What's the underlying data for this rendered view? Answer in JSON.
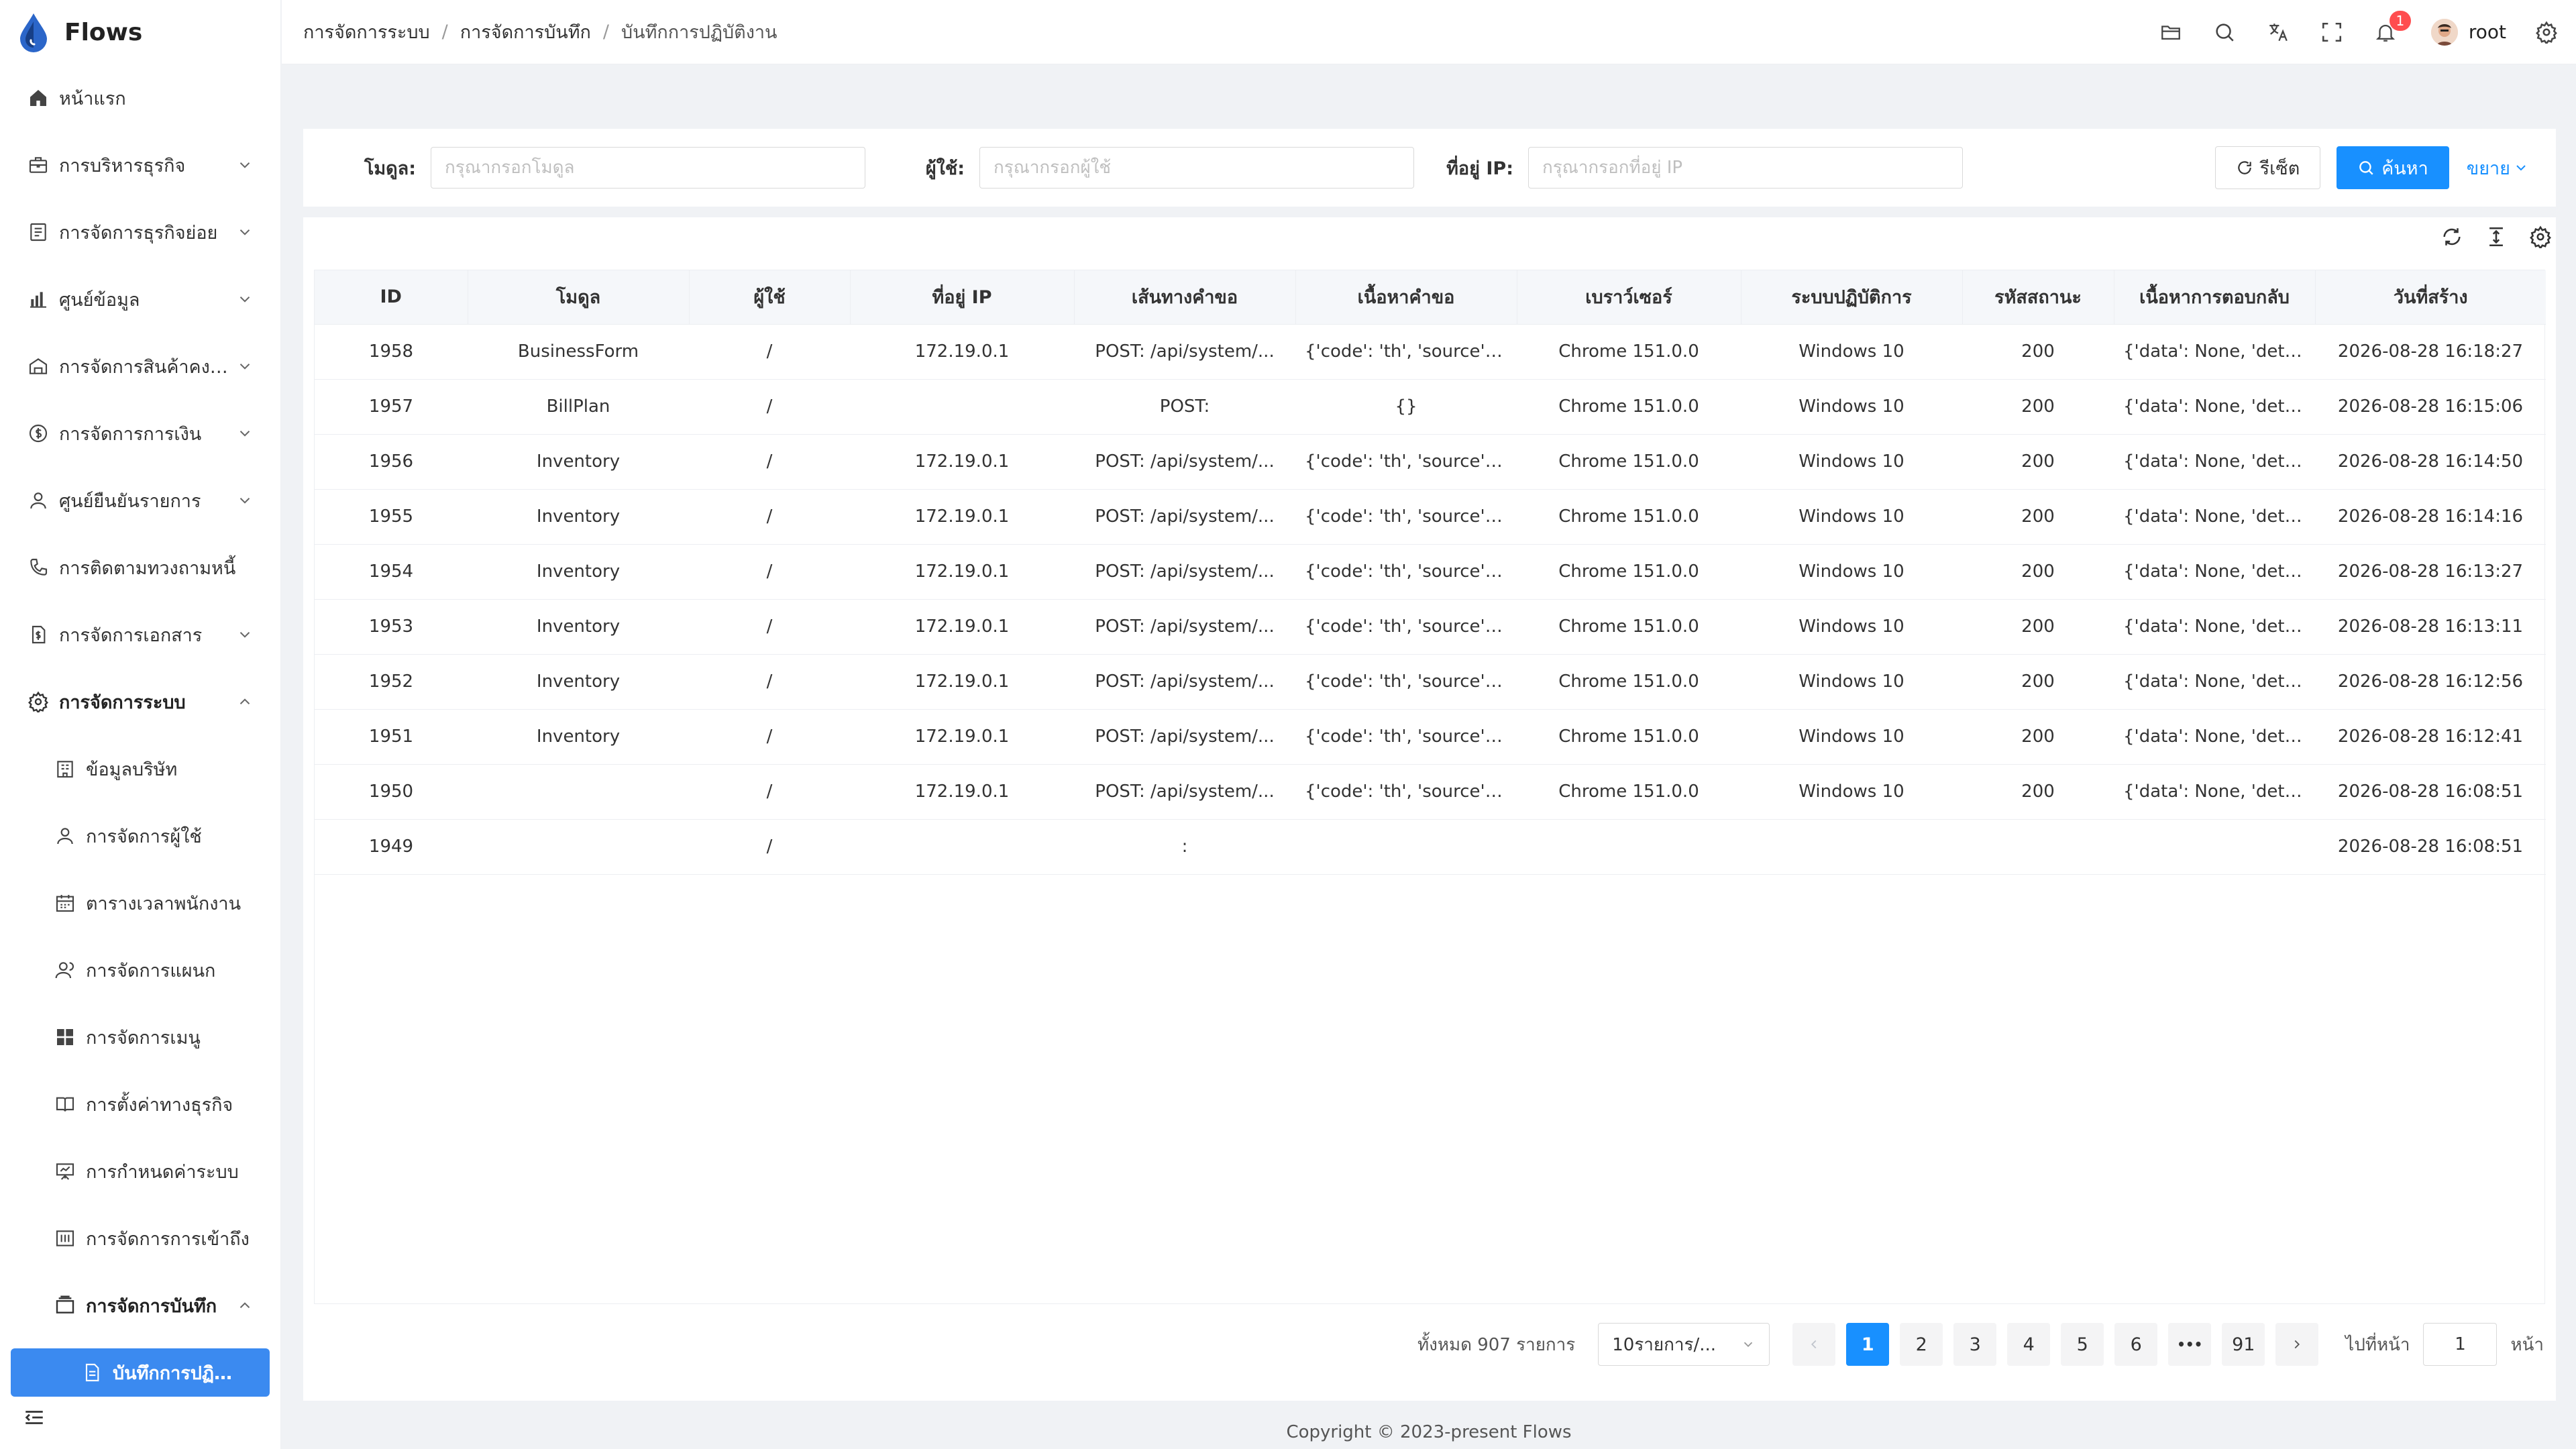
{
  "app": {
    "name": "Flows"
  },
  "sidebar": {
    "items": [
      {
        "label": "หน้าแรก",
        "icon": "home-icon"
      },
      {
        "label": "การบริหารธุรกิจ",
        "icon": "briefcase-icon"
      },
      {
        "label": "การจัดการธุรกิจย่อย",
        "icon": "document-list-icon"
      },
      {
        "label": "ศูนย์ข้อมูล",
        "icon": "bar-chart-icon"
      },
      {
        "label": "การจัดการสินค้าคงคลัง",
        "icon": "warehouse-icon"
      },
      {
        "label": "การจัดการการเงิน",
        "icon": "money-icon"
      },
      {
        "label": "ศูนย์ยืนยันรายการ",
        "icon": "user-check-icon"
      },
      {
        "label": "การติดตามทวงถามหนี้",
        "icon": "phone-icon"
      },
      {
        "label": "การจัดการเอกสาร",
        "icon": "file-dollar-icon"
      },
      {
        "label": "การจัดการระบบ",
        "icon": "gear-icon"
      }
    ],
    "system_children": [
      {
        "label": "ข้อมูลบริษัท",
        "icon": "building-icon"
      },
      {
        "label": "การจัดการผู้ใช้",
        "icon": "user-icon"
      },
      {
        "label": "ตารางเวลาพนักงาน",
        "icon": "calendar-icon"
      },
      {
        "label": "การจัดการแผนก",
        "icon": "team-icon"
      },
      {
        "label": "การจัดการเมนู",
        "icon": "grid-icon"
      },
      {
        "label": "การตั้งค่าทางธุรกิจ",
        "icon": "book-icon"
      },
      {
        "label": "การกำหนดค่าระบบ",
        "icon": "presentation-icon"
      },
      {
        "label": "การจัดการการเข้าถึง",
        "icon": "access-icon"
      },
      {
        "label": "การจัดการบันทึก",
        "icon": "log-box-icon"
      }
    ],
    "active_item": "บันทึกการปฏิบัติงาน"
  },
  "header": {
    "breadcrumb": [
      "การจัดการระบบ",
      "การจัดการบันทึก",
      "บันทึกการปฏิบัติงาน"
    ],
    "notification_count": "1",
    "username": "root"
  },
  "search": {
    "module_label": "โมดูล:",
    "module_placeholder": "กรุณากรอกโมดูล",
    "user_label": "ผู้ใช้:",
    "user_placeholder": "กรุณากรอกผู้ใช้",
    "ip_label": "ที่อยู่ IP:",
    "ip_placeholder": "กรุณากรอกที่อยู่ IP",
    "reset_label": "รีเซ็ต",
    "search_label": "ค้นหา",
    "expand_label": "ขยาย"
  },
  "table": {
    "columns": [
      "ID",
      "โมดูล",
      "ผู้ใช้",
      "ที่อยู่ IP",
      "เส้นทางคำขอ",
      "เนื้อหาคำขอ",
      "เบราว์เซอร์",
      "ระบบปฏิบัติการ",
      "รหัสสถานะ",
      "เนื้อหาการตอบกลับ",
      "วันที่สร้าง"
    ],
    "rows": [
      [
        "1958",
        "BusinessForm",
        "/",
        "172.19.0.1",
        "POST: /api/system/...",
        "{'code': 'th', 'source':...",
        "Chrome 151.0.0",
        "Windows 10",
        "200",
        "{'data': None, 'detail'...",
        "2026-08-28 16:18:27"
      ],
      [
        "1957",
        "BillPlan",
        "/",
        "",
        "POST:",
        "{}",
        "Chrome 151.0.0",
        "Windows 10",
        "200",
        "{'data': None, 'detail'...",
        "2026-08-28 16:15:06"
      ],
      [
        "1956",
        "Inventory",
        "/",
        "172.19.0.1",
        "POST: /api/system/...",
        "{'code': 'th', 'source':...",
        "Chrome 151.0.0",
        "Windows 10",
        "200",
        "{'data': None, 'detail'...",
        "2026-08-28 16:14:50"
      ],
      [
        "1955",
        "Inventory",
        "/",
        "172.19.0.1",
        "POST: /api/system/...",
        "{'code': 'th', 'source':...",
        "Chrome 151.0.0",
        "Windows 10",
        "200",
        "{'data': None, 'detail'...",
        "2026-08-28 16:14:16"
      ],
      [
        "1954",
        "Inventory",
        "/",
        "172.19.0.1",
        "POST: /api/system/...",
        "{'code': 'th', 'source':...",
        "Chrome 151.0.0",
        "Windows 10",
        "200",
        "{'data': None, 'detail'...",
        "2026-08-28 16:13:27"
      ],
      [
        "1953",
        "Inventory",
        "/",
        "172.19.0.1",
        "POST: /api/system/...",
        "{'code': 'th', 'source':...",
        "Chrome 151.0.0",
        "Windows 10",
        "200",
        "{'data': None, 'detail'...",
        "2026-08-28 16:13:11"
      ],
      [
        "1952",
        "Inventory",
        "/",
        "172.19.0.1",
        "POST: /api/system/...",
        "{'code': 'th', 'source':...",
        "Chrome 151.0.0",
        "Windows 10",
        "200",
        "{'data': None, 'detail'...",
        "2026-08-28 16:12:56"
      ],
      [
        "1951",
        "Inventory",
        "/",
        "172.19.0.1",
        "POST: /api/system/...",
        "{'code': 'th', 'source':...",
        "Chrome 151.0.0",
        "Windows 10",
        "200",
        "{'data': None, 'detail'...",
        "2026-08-28 16:12:41"
      ],
      [
        "1950",
        "",
        "/",
        "172.19.0.1",
        "POST: /api/system/...",
        "{'code': 'th', 'source':...",
        "Chrome 151.0.0",
        "Windows 10",
        "200",
        "{'data': None, 'detail'...",
        "2026-08-28 16:08:51"
      ],
      [
        "1949",
        "",
        "/",
        "",
        ":",
        "",
        "",
        "",
        "",
        "",
        "2026-08-28 16:08:51"
      ]
    ]
  },
  "pagination": {
    "total_text": "ทั้งหมด 907 รายการ",
    "page_size": "10รายการ/...",
    "pages": [
      "1",
      "2",
      "3",
      "4",
      "5",
      "6",
      "•••",
      "91"
    ],
    "current_page": "1",
    "goto_label": "ไปที่หน้า",
    "goto_value": "1",
    "goto_suffix": "หน้า"
  },
  "footer": {
    "text": "Copyright © 2023-present Flows"
  },
  "colors": {
    "accent": "#1890ff",
    "sidebar_active": "#3b8af0",
    "badge": "#ff4d4f"
  }
}
